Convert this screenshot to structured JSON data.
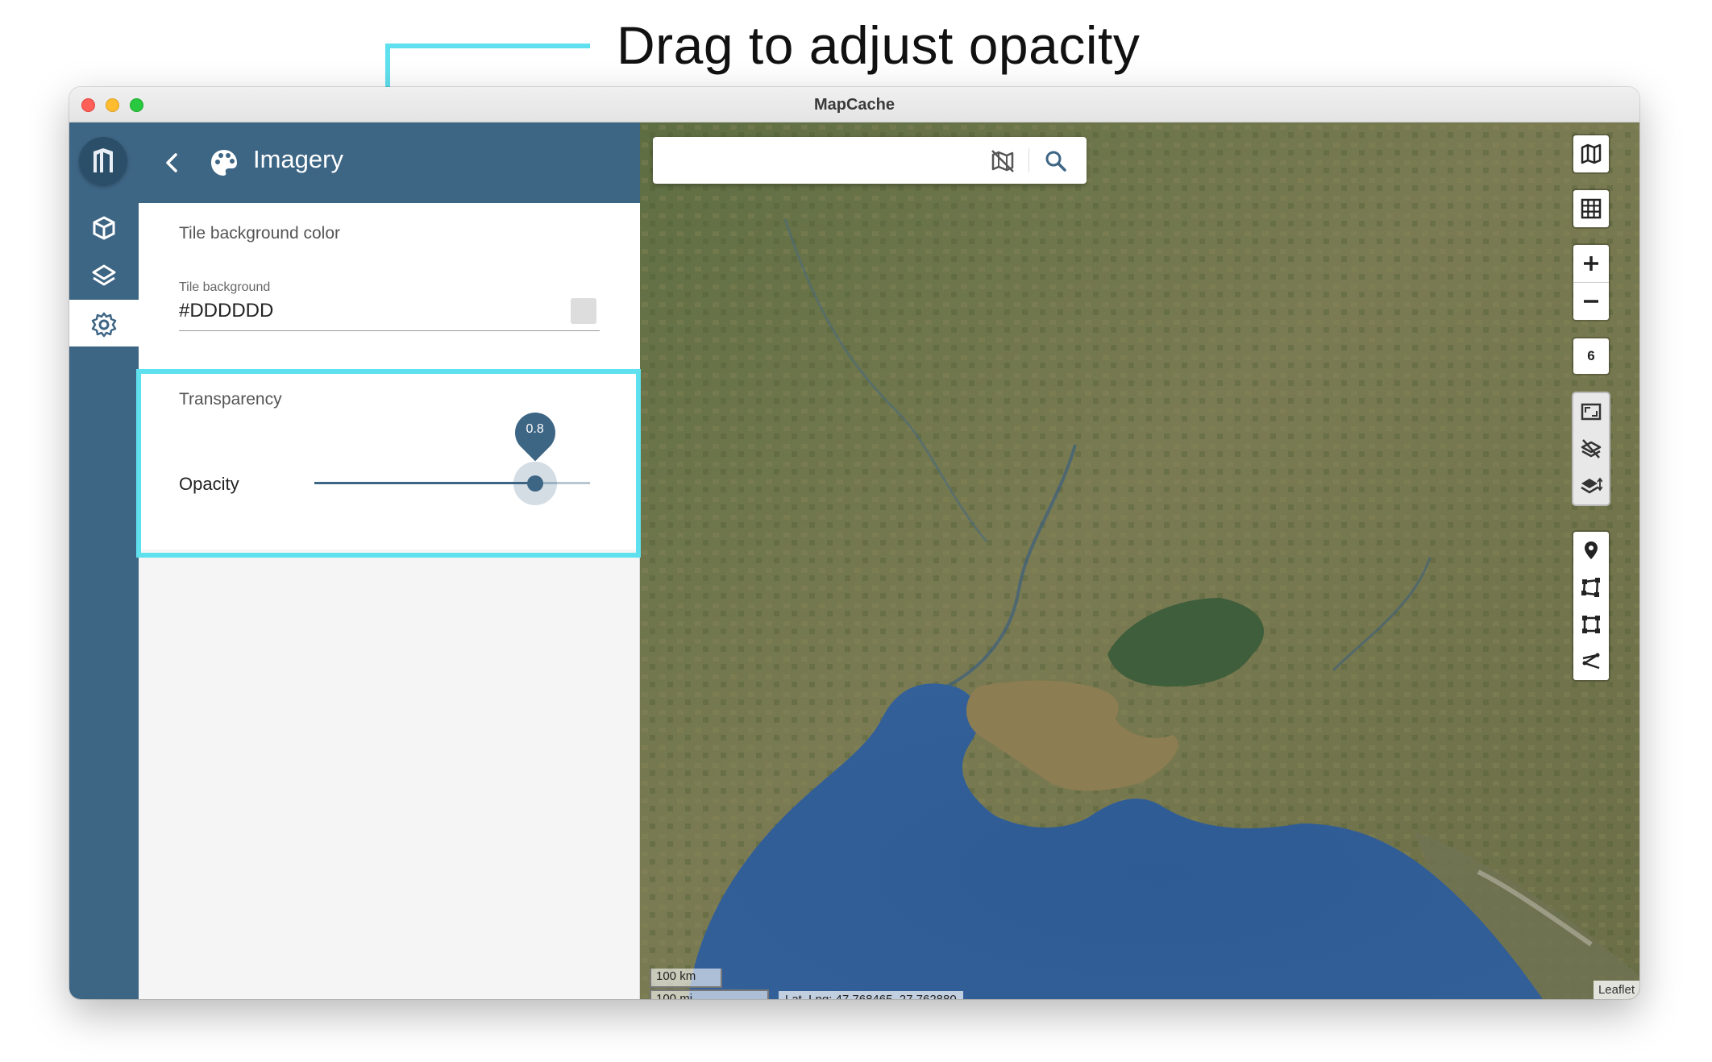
{
  "annotation": {
    "text": "Drag to adjust opacity",
    "color": "#5fe0ee"
  },
  "window": {
    "title": "MapCache"
  },
  "nav_rail": {
    "items": [
      {
        "name": "projects",
        "icon": "cube-icon"
      },
      {
        "name": "layers",
        "icon": "layers-icon"
      },
      {
        "name": "settings",
        "icon": "gear-icon",
        "active": true
      }
    ]
  },
  "panel": {
    "title": "Imagery",
    "title_icon": "palette-icon",
    "tile_background": {
      "section_label": "Tile background color",
      "field_label": "Tile background",
      "value": "#DDDDDD"
    },
    "transparency": {
      "section_label": "Transparency",
      "opacity_label": "Opacity",
      "opacity_value": "0.8",
      "slider_fraction": 0.8
    }
  },
  "map": {
    "search_placeholder": "",
    "zoom_level": "6",
    "scale_km": "100 km",
    "scale_mi": "100 mi",
    "coordinates": "Lat, Lng: 47.768465, 27.762880",
    "attribution": "Leaflet",
    "controls": [
      "map-icon",
      "grid-icon",
      "zoom-in-icon",
      "zoom-out-icon",
      "fit-bounds-icon",
      "hide-layers-icon",
      "layer-order-icon",
      "marker-icon",
      "polygon-icon",
      "rectangle-icon",
      "polyline-icon"
    ]
  },
  "colors": {
    "accent": "#3d6584",
    "highlight": "#5fe0ee",
    "tile_background": "#dddddd"
  }
}
